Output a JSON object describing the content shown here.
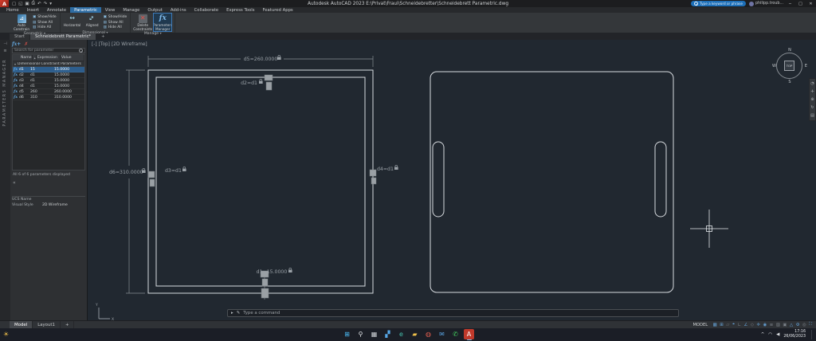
{
  "titlebar": {
    "app_logo": "A",
    "quick_access_icons": [
      {
        "name": "new-drawing-icon",
        "glyph": "▢"
      },
      {
        "name": "open-icon",
        "glyph": "◱"
      },
      {
        "name": "save-icon",
        "glyph": "▣"
      },
      {
        "name": "plot-icon",
        "glyph": "⎙"
      },
      {
        "name": "undo-icon",
        "glyph": "↶"
      },
      {
        "name": "redo-icon",
        "glyph": "↷"
      },
      {
        "name": "qat-dropdown-icon",
        "glyph": "▾"
      }
    ],
    "app_title": "Autodesk AutoCAD 2023   E:\\Privat\\Fraui\\Schneidebretter\\Schneidebrett Parametric.dwg",
    "search_placeholder": "Type a keyword or phrase",
    "user_name": "philipp.troub...",
    "window_buttons": {
      "minimize": "─",
      "maximize": "□",
      "close": "✕"
    }
  },
  "ribbon": {
    "tabs": [
      {
        "label": "Home"
      },
      {
        "label": "Insert"
      },
      {
        "label": "Annotate"
      },
      {
        "label": "Parametric",
        "active": true
      },
      {
        "label": "View"
      },
      {
        "label": "Manage"
      },
      {
        "label": "Output"
      },
      {
        "label": "Add-ins"
      },
      {
        "label": "Collaborate"
      },
      {
        "label": "Express Tools"
      },
      {
        "label": "Featured Apps"
      }
    ],
    "geometric": {
      "caption": "Geometric",
      "auto_constrain": "Auto Constrain",
      "show_hide": "Show/Hide",
      "show_all": "Show All",
      "hide_all": "Hide All"
    },
    "dimensional": {
      "caption": "Dimensional",
      "horizontal": "Horizontal",
      "aligned": "Aligned",
      "show_hide": "Show/Hide",
      "show_all": "Show All",
      "hide_all": "Hide All"
    },
    "manage": {
      "caption": "Manage",
      "delete_constraints": "Delete Constraints",
      "parameters_manager": "Parameters Manager"
    }
  },
  "file_tabs": {
    "start": "Start",
    "drawing": "Schneidebrett Parametric*",
    "new_tab": "+"
  },
  "palette": {
    "title": "PARAMETERS MANAGER",
    "search_placeholder": "Search for parameter",
    "columns": {
      "name": "Name",
      "expression": "Expression",
      "value": "Value"
    },
    "sort_icon": "▴",
    "group": "Dimensional Constraint Parameters",
    "rows": [
      {
        "name": "d1",
        "expression": "15",
        "value": "15.0000",
        "selected": true
      },
      {
        "name": "d2",
        "expression": "d1",
        "value": "15.0000"
      },
      {
        "name": "d3",
        "expression": "d1",
        "value": "15.0000"
      },
      {
        "name": "d4",
        "expression": "d1",
        "value": "15.0000"
      },
      {
        "name": "d5",
        "expression": "260",
        "value": "260.0000"
      },
      {
        "name": "d6",
        "expression": "310",
        "value": "310.0000"
      }
    ],
    "footer": "All 6 of 6 parameters displayed"
  },
  "properties": {
    "ucs_label": "UCS Name",
    "ucs_value": "",
    "visual_style_label": "Visual Style",
    "visual_style_value": "2D Wireframe"
  },
  "viewport": {
    "minus": "[-]",
    "view": "[Top]",
    "style": "[2D Wireframe]"
  },
  "drawing": {
    "annotations": {
      "d5": "d5=260.0000",
      "d6": "d6=310.0000",
      "d2": "d2=d1",
      "d3": "d3=d1",
      "d4": "d4=d1",
      "d1": "d1=15.0000"
    },
    "locked": true
  },
  "viewcube": {
    "north": "N",
    "south": "S",
    "east": "E",
    "west": "W",
    "face": "TOP"
  },
  "navbar_icons": [
    {
      "name": "navigation-wheel-icon",
      "glyph": "◔"
    },
    {
      "name": "pan-icon",
      "glyph": "✛"
    },
    {
      "name": "zoom-icon",
      "glyph": "⊕"
    },
    {
      "name": "orbit-icon",
      "glyph": "↻"
    },
    {
      "name": "showmotion-icon",
      "glyph": "▤"
    }
  ],
  "command_line": {
    "placeholder": "Type a command"
  },
  "statusbar": {
    "model_tab": "Model",
    "layout_tab": "Layout1",
    "new_layout": "+",
    "mode_label": "MODEL",
    "icons": [
      {
        "name": "grid-display-icon",
        "glyph": "▦",
        "on": true
      },
      {
        "name": "snap-mode-icon",
        "glyph": "⊞",
        "on": true
      },
      {
        "name": "infer-constraints-icon",
        "glyph": "▱"
      },
      {
        "name": "dynamic-input-icon",
        "glyph": "⌖",
        "on": true
      },
      {
        "name": "ortho-mode-icon",
        "glyph": "∟"
      },
      {
        "name": "polar-tracking-icon",
        "glyph": "∠",
        "on": true
      },
      {
        "name": "isometric-drafting-icon",
        "glyph": "◇"
      },
      {
        "name": "object-snap-tracking-icon",
        "glyph": "✛",
        "on": true
      },
      {
        "name": "object-snap-icon",
        "glyph": "◉",
        "on": true
      },
      {
        "name": "lineweight-icon",
        "glyph": "≡"
      },
      {
        "name": "transparency-icon",
        "glyph": "▨"
      },
      {
        "name": "selection-cycling-icon",
        "glyph": "▣"
      },
      {
        "name": "annotation-scale-icon",
        "glyph": "△",
        "on": true
      },
      {
        "name": "workspace-switching-icon",
        "glyph": "⚙",
        "on": true
      },
      {
        "name": "annotation-monitor-icon",
        "glyph": "◎"
      },
      {
        "name": "clean-screen-icon",
        "glyph": "⛶",
        "on": true
      }
    ]
  },
  "taskbar": {
    "weather": "☀",
    "icons": [
      {
        "name": "start-button",
        "glyph": "⊞",
        "color": "#4cc2ff"
      },
      {
        "name": "search-button",
        "glyph": "⚲",
        "color": "#e4e7ea"
      },
      {
        "name": "task-view-button",
        "glyph": "▦",
        "color": "#cdd1d5"
      },
      {
        "name": "widgets-button",
        "glyph": "▞",
        "color": "#57a8e8"
      },
      {
        "name": "edge-browser-button",
        "glyph": "e",
        "color": "#47c1ae"
      },
      {
        "name": "file-explorer-button",
        "glyph": "▰",
        "color": "#f1c14b"
      },
      {
        "name": "browser-button",
        "glyph": "◍",
        "color": "#e25d4f"
      },
      {
        "name": "mail-button",
        "glyph": "✉",
        "color": "#58a2e0"
      },
      {
        "name": "whatsapp-button",
        "glyph": "✆",
        "color": "#43cd5e"
      },
      {
        "name": "autocad-taskbar-button",
        "glyph": "A",
        "color": "#ffffff",
        "bg": "#c0392b",
        "active": true
      }
    ],
    "tray": {
      "hidden_icons": "^",
      "network": "◠",
      "volume": "◀",
      "time": "17:16",
      "date": "26/06/2023"
    }
  }
}
